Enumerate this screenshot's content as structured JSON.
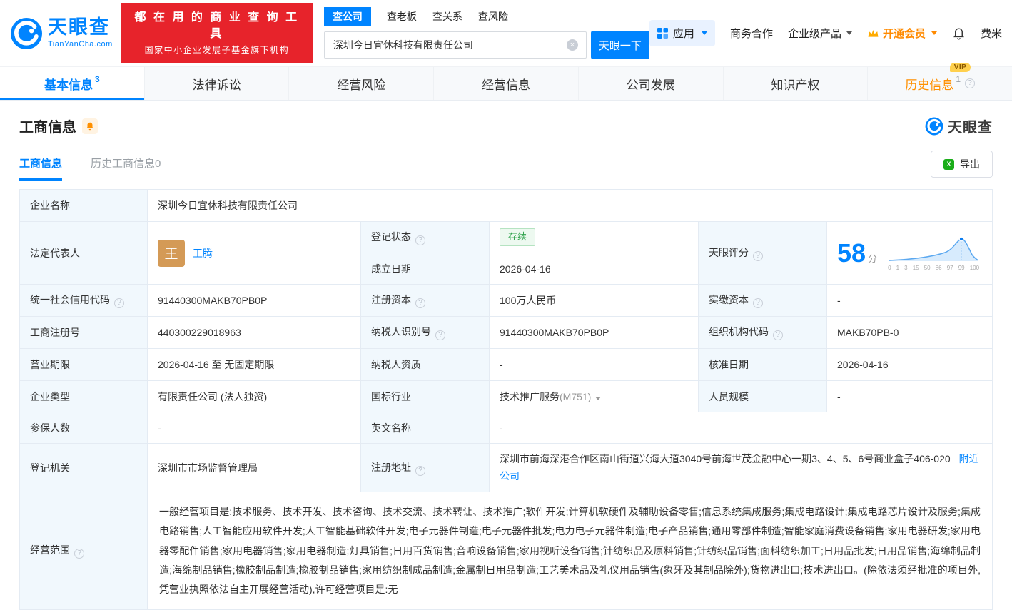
{
  "icons": {
    "help": "?",
    "clear": "×",
    "excel_glyph": "X"
  },
  "header": {
    "logo_brand": "天眼查",
    "logo_domain": "TianYanCha.com",
    "slogan_line1": "都 在 用 的 商 业 查 询 工 具",
    "slogan_line2": "国家中小企业发展子基金旗下机构",
    "search_tabs": [
      {
        "label": "查公司"
      },
      {
        "label": "查老板"
      },
      {
        "label": "查关系"
      },
      {
        "label": "查风险"
      }
    ],
    "search_value": "深圳今日宜休科技有限责任公司",
    "search_button": "天眼一下",
    "apps_label": "应用",
    "biz_coop": "商务合作",
    "enterprise_product": "企业级产品",
    "vip_label": "开通会员",
    "username": "费米"
  },
  "nav_tabs": [
    {
      "label": "基本信息",
      "badge": "3"
    },
    {
      "label": "法律诉讼",
      "badge": ""
    },
    {
      "label": "经营风险",
      "badge": ""
    },
    {
      "label": "经营信息",
      "badge": ""
    },
    {
      "label": "公司发展",
      "badge": ""
    },
    {
      "label": "知识产权",
      "badge": ""
    },
    {
      "label": "历史信息",
      "badge": "1",
      "vip_tag": "VIP"
    }
  ],
  "section": {
    "title": "工商信息",
    "watermark_brand": "天眼查",
    "subtab_active": "工商信息",
    "subtab_history": "历史工商信息0",
    "export_label": "导出"
  },
  "info": {
    "company_name_label": "企业名称",
    "company_name": "深圳今日宜休科技有限责任公司",
    "legal_rep_label": "法定代表人",
    "legal_rep_avatar": "王",
    "legal_rep_name": "王腾",
    "reg_status_label": "登记状态",
    "reg_status": "存续",
    "establish_label": "成立日期",
    "establish_date": "2026-04-16",
    "score_label": "天眼评分",
    "score_value": "58",
    "score_unit": "分",
    "score_ticks": [
      "0",
      "1",
      "3",
      "15",
      "50",
      "86",
      "97",
      "99",
      "100"
    ],
    "credit_code_label": "统一社会信用代码",
    "credit_code": "91440300MAKB70PB0P",
    "reg_capital_label": "注册资本",
    "reg_capital": "100万人民币",
    "paid_capital_label": "实缴资本",
    "paid_capital": "-",
    "reg_number_label": "工商注册号",
    "reg_number": "440300229018963",
    "taxpayer_id_label": "纳税人识别号",
    "taxpayer_id": "91440300MAKB70PB0P",
    "org_code_label": "组织机构代码",
    "org_code": "MAKB70PB-0",
    "business_term_label": "营业期限",
    "business_term": "2026-04-16 至 无固定期限",
    "taxpayer_quality_label": "纳税人资质",
    "taxpayer_quality": "-",
    "approval_date_label": "核准日期",
    "approval_date": "2026-04-16",
    "company_type_label": "企业类型",
    "company_type": "有限责任公司 (法人独资)",
    "industry_label": "国标行业",
    "industry": "技术推广服务",
    "industry_code": "(M751)",
    "staff_size_label": "人员规模",
    "staff_size": "-",
    "insured_label": "参保人数",
    "insured": "-",
    "english_name_label": "英文名称",
    "english_name": "-",
    "reg_authority_label": "登记机关",
    "reg_authority": "深圳市市场监督管理局",
    "reg_address_label": "注册地址",
    "reg_address": "深圳市前海深港合作区南山街道兴海大道3040号前海世茂金融中心一期3、4、5、6号商业盒子406-020",
    "nearby_link": "附近公司",
    "business_scope_label": "经营范围",
    "business_scope": "一般经营项目是:技术服务、技术开发、技术咨询、技术交流、技术转让、技术推广;软件开发;计算机软硬件及辅助设备零售;信息系统集成服务;集成电路设计;集成电路芯片设计及服务;集成电路销售;人工智能应用软件开发;人工智能基础软件开发;电子元器件制造;电子元器件批发;电力电子元器件制造;电子产品销售;通用零部件制造;智能家庭消费设备销售;家用电器研发;家用电器零配件销售;家用电器销售;家用电器制造;灯具销售;日用百货销售;音响设备销售;家用视听设备销售;针纺织品及原料销售;针纺织品销售;面料纺织加工;日用品批发;日用品销售;海绵制品制造;海绵制品销售;橡胶制品制造;橡胶制品销售;家用纺织制成品制造;金属制日用品制造;工艺美术品及礼仪用品销售(象牙及其制品除外);货物进出口;技术进出口。(除依法须经批准的项目外,凭营业执照依法自主开展经营活动),许可经营项目是:无"
  }
}
